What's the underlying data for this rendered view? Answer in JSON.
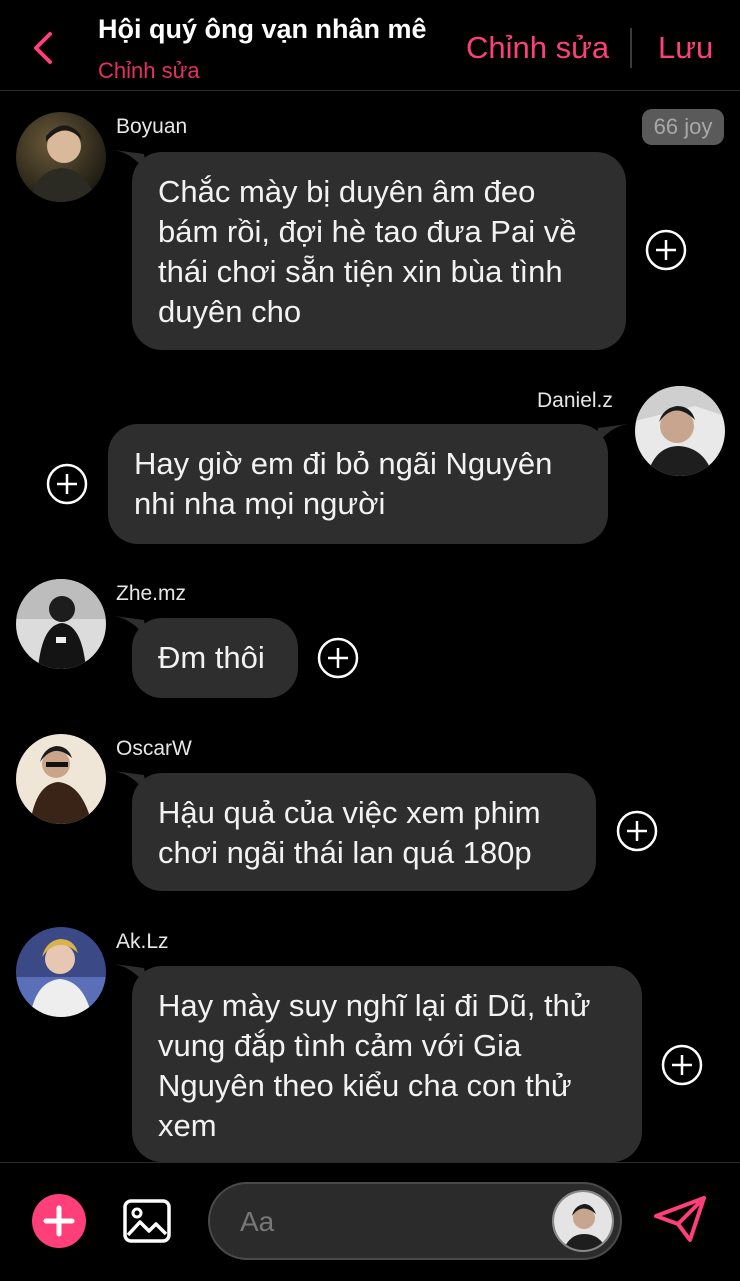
{
  "header": {
    "title": "Hội quý ông vạn nhân mê",
    "subtitle": "Chỉnh sửa",
    "edit_label": "Chỉnh sửa",
    "save_label": "Lưu"
  },
  "badge": "66 joy",
  "messages": [
    {
      "user": "Boyuan",
      "text": "Chắc mày bị duyên âm đeo bám rồi, đợi hè tao đưa Pai về thái chơi sẵn tiện xin bùa tình duyên cho",
      "side": "left"
    },
    {
      "user": "Daniel.z",
      "text": "Hay giờ em đi bỏ ngãi Nguyên nhi nha mọi người",
      "side": "right"
    },
    {
      "user": "Zhe.mz",
      "text": "Đm thôi",
      "side": "left"
    },
    {
      "user": "OscarW",
      "text": "Hậu quả của việc xem phim chơi ngãi thái lan quá 180p",
      "side": "left"
    },
    {
      "user": "Ak.Lz",
      "text": "Hay mày suy nghĩ lại đi Dũ, thử vung đắp tình cảm với Gia Nguyên theo kiểu cha con thử xem",
      "side": "left"
    }
  ],
  "composer": {
    "placeholder": "Aa"
  },
  "colors": {
    "accent": "#ff3f79",
    "bubble": "#2e2e2e",
    "background": "#000000"
  },
  "icons": [
    "back-chevron-icon",
    "plus-circle-icon",
    "add-icon",
    "image-icon",
    "send-icon"
  ]
}
